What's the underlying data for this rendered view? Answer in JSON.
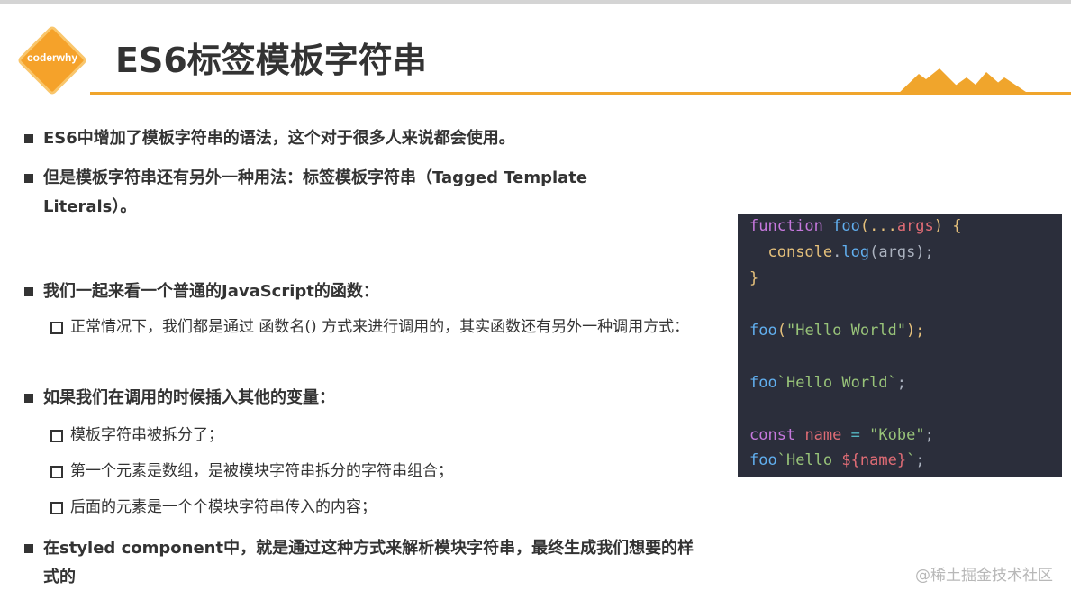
{
  "logo": {
    "text": "coderwhy"
  },
  "title": "ES6标签模板字符串",
  "bullets": [
    {
      "text": "ES6中增加了模板字符串的语法，这个对于很多人来说都会使用。"
    },
    {
      "text": "但是模板字符串还有另外一种用法：标签模板字符串（Tagged Template Literals）。"
    },
    {
      "text": "我们一起来看一个普通的JavaScript的函数："
    },
    {
      "text": "正常情况下，我们都是通过 函数名() 方式来进行调用的，其实函数还有另外一种调用方式："
    },
    {
      "text": "如果我们在调用的时候插入其他的变量："
    },
    {
      "text": "模板字符串被拆分了；"
    },
    {
      "text": "第一个元素是数组，是被模块字符串拆分的字符串组合；"
    },
    {
      "text": "后面的元素是一个个模块字符串传入的内容；"
    },
    {
      "text": "在styled component中，就是通过这种方式来解析模块字符串，最终生成我们想要的样式的"
    }
  ],
  "code": {
    "line1": [
      "function",
      "foo",
      "(...",
      "args",
      ")",
      "{"
    ],
    "line2": [
      "console",
      ".",
      "log",
      "(",
      "args",
      ");"
    ],
    "line3": "}",
    "line4": [
      "foo",
      "(",
      "\"Hello World\"",
      ");"
    ],
    "line5": [
      "foo",
      "`Hello World`",
      ";"
    ],
    "line6": [
      "const",
      "name",
      "=",
      "\"Kobe\"",
      ";"
    ],
    "line7": [
      "foo",
      "`Hello ",
      "${",
      "name",
      "}",
      "`",
      ";"
    ]
  },
  "watermark": "@稀土掘金技术社区",
  "colors": {
    "accent": "#f0a52c",
    "code_bg": "#2b2e3b"
  }
}
